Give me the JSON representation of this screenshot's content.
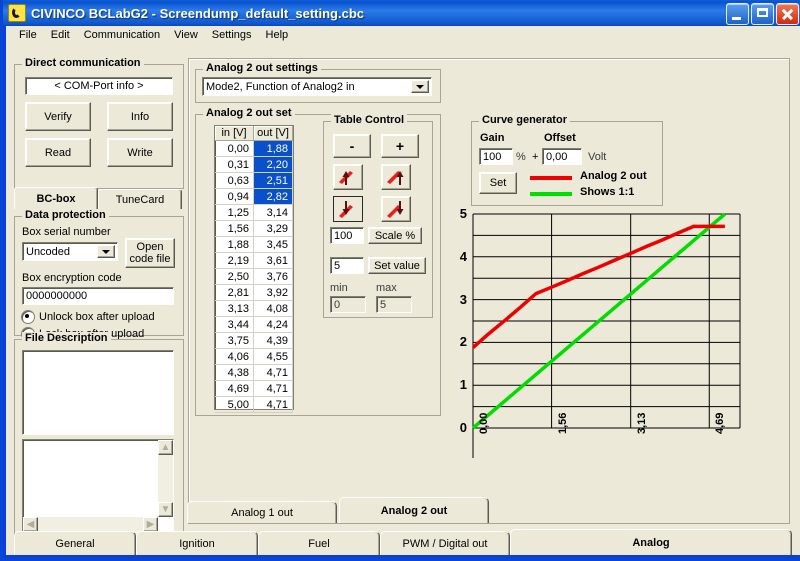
{
  "window": {
    "title": "CIVINCO  BCLabG2 - Screendump_default_setting.cbc",
    "icon": "civinco-logo-icon",
    "minimize": "minimize-icon",
    "maximize": "maximize-icon",
    "close": "close-icon"
  },
  "menu": [
    "File",
    "Edit",
    "Communication",
    "View",
    "Settings",
    "Help"
  ],
  "left_panel": {
    "direct_communication": {
      "title": "Direct communication",
      "com_port": "< COM-Port info >",
      "buttons": [
        "Verify",
        "Info",
        "Read",
        "Write"
      ]
    },
    "tabs": [
      {
        "label": "BC-box",
        "selected": true
      },
      {
        "label": "TuneCard",
        "selected": false
      }
    ],
    "data_protection": {
      "title": "Data protection",
      "serial_label": "Box serial number",
      "serial_value": "Uncoded",
      "open_code_file": "Open\ncode file",
      "open_code_file_line1": "Open",
      "open_code_file_line2": "code file",
      "encryption_label": "Box encryption code",
      "encryption_value": "0000000000",
      "radio_unlock": "Unlock box after upload",
      "radio_lock": "Lock box after upload",
      "radio_selected": "unlock"
    },
    "file_description": {
      "title": "File Description",
      "text_top": "",
      "text_bottom": ""
    }
  },
  "main": {
    "settings_group_title": "Analog 2 out settings",
    "mode_value": "Mode2, Function of Analog2 in",
    "set_group_title": "Analog 2 out set",
    "table": {
      "headers": [
        "in [V]",
        "out [V]"
      ],
      "rows": [
        {
          "in": "0,00",
          "out": "1,88",
          "selected": true
        },
        {
          "in": "0,31",
          "out": "2,20",
          "selected": true
        },
        {
          "in": "0,63",
          "out": "2,51",
          "selected": true
        },
        {
          "in": "0,94",
          "out": "2,82",
          "selected": true
        },
        {
          "in": "1,25",
          "out": "3,14",
          "selected": false
        },
        {
          "in": "1,56",
          "out": "3,29",
          "selected": false
        },
        {
          "in": "1,88",
          "out": "3,45",
          "selected": false
        },
        {
          "in": "2,19",
          "out": "3,61",
          "selected": false
        },
        {
          "in": "2,50",
          "out": "3,76",
          "selected": false
        },
        {
          "in": "2,81",
          "out": "3,92",
          "selected": false
        },
        {
          "in": "3,13",
          "out": "4,08",
          "selected": false
        },
        {
          "in": "3,44",
          "out": "4,24",
          "selected": false
        },
        {
          "in": "3,75",
          "out": "4,39",
          "selected": false
        },
        {
          "in": "4,06",
          "out": "4,55",
          "selected": false
        },
        {
          "in": "4,38",
          "out": "4,71",
          "selected": false
        },
        {
          "in": "4,69",
          "out": "4,71",
          "selected": false
        },
        {
          "in": "5,00",
          "out": "4,71",
          "selected": false
        }
      ]
    },
    "table_control": {
      "title": "Table Control",
      "minus": "-",
      "plus": "+",
      "icon_buttons": [
        {
          "name": "slope-up-left-icon"
        },
        {
          "name": "slope-up-right-icon"
        },
        {
          "name": "slope-down-left-icon",
          "pressed": true
        },
        {
          "name": "slope-down-right-icon"
        }
      ],
      "scale_value": "100",
      "scale_label": "Scale %",
      "set_value_input": "5",
      "set_value_label": "Set value",
      "min_label": "min",
      "max_label": "max",
      "min_value": "0",
      "max_value": "5"
    },
    "curve_generator": {
      "title": "Curve generator",
      "gain_label": "Gain",
      "offset_label": "Offset",
      "gain_value": "100",
      "percent": "%",
      "plus": "+",
      "offset_value": "0,00",
      "volt": "Volt",
      "set_button": "Set",
      "legend": [
        {
          "label": "Analog 2 out",
          "color": "#ee0000"
        },
        {
          "label": "Shows 1:1",
          "color": "#00dd00"
        }
      ]
    },
    "sub_tabs": [
      {
        "label": "Analog 1 out",
        "selected": false
      },
      {
        "label": "Analog 2 out",
        "selected": true
      }
    ]
  },
  "bottom_tabs": [
    {
      "label": "General",
      "selected": false
    },
    {
      "label": "Ignition",
      "selected": false
    },
    {
      "label": "Fuel",
      "selected": false
    },
    {
      "label": "PWM / Digital out",
      "selected": false
    },
    {
      "label": "Analog",
      "selected": true
    }
  ],
  "chart_data": {
    "type": "line",
    "title": "",
    "xlabel": "",
    "ylabel": "",
    "xlim": [
      0,
      5.3
    ],
    "ylim": [
      0,
      5
    ],
    "grid": true,
    "y_ticks": [
      0,
      1,
      2,
      3,
      4,
      5
    ],
    "y_minor_step": 0.5,
    "x_ticks": [
      0,
      1.56,
      3.13,
      4.69
    ],
    "x_tick_labels": [
      "0,00",
      "1,56",
      "3,13",
      "4,69"
    ],
    "legend_position": "above-right",
    "series": [
      {
        "name": "Analog 2 out",
        "color": "#ee0000",
        "x": [
          0.0,
          0.31,
          0.63,
          0.94,
          1.25,
          1.56,
          1.88,
          2.19,
          2.5,
          2.81,
          3.13,
          3.44,
          3.75,
          4.06,
          4.38,
          4.69,
          5.0
        ],
        "y": [
          1.88,
          2.2,
          2.51,
          2.82,
          3.14,
          3.29,
          3.45,
          3.61,
          3.76,
          3.92,
          4.08,
          4.24,
          4.39,
          4.55,
          4.71,
          4.71,
          4.71
        ]
      },
      {
        "name": "Shows 1:1",
        "color": "#00dd00",
        "x": [
          0.0,
          5.0
        ],
        "y": [
          0.0,
          5.0
        ]
      }
    ]
  }
}
